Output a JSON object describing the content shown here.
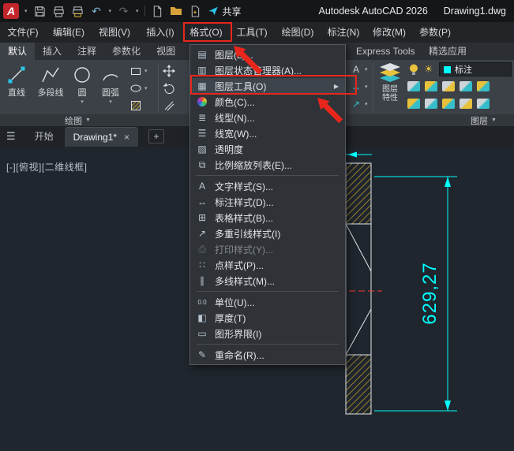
{
  "theme": {
    "accent_red": "#e8261c",
    "logo_red": "#c2262c",
    "dim_cyan": "#00ffff",
    "hatch_yellow": "#b79a2f",
    "centerline_red": "#ff3b30",
    "share_cyan": "#2bc3e8",
    "icon_yellow": "#e8c23c",
    "icon_teal": "#35bdc9"
  },
  "titlebar": {
    "logo_letter": "A",
    "share_label": "共享",
    "app_title": "Autodesk AutoCAD 2026",
    "doc_title": "Drawing1.dwg"
  },
  "menubar": {
    "items": [
      {
        "label": "文件(F)"
      },
      {
        "label": "编辑(E)"
      },
      {
        "label": "视图(V)"
      },
      {
        "label": "插入(I)"
      },
      {
        "label": "格式(O)"
      },
      {
        "label": "工具(T)"
      },
      {
        "label": "绘图(D)"
      },
      {
        "label": "标注(N)"
      },
      {
        "label": "修改(M)"
      },
      {
        "label": "参数(P)"
      }
    ]
  },
  "format_menu": {
    "submenu_glyph": "▶",
    "items": [
      {
        "label": "图层(L)...",
        "glyph": "▤"
      },
      {
        "label": "图层状态管理器(A)...",
        "glyph": "▥"
      },
      {
        "label": "图层工具(O)",
        "glyph": "▦"
      },
      {
        "label": "颜色(C)..."
      },
      {
        "label": "线型(N)...",
        "glyph": "≣"
      },
      {
        "label": "线宽(W)...",
        "glyph": "☰"
      },
      {
        "label": "透明度",
        "glyph": "▨"
      },
      {
        "label": "比例缩放列表(E)...",
        "glyph": "⧉"
      },
      {
        "label": "文字样式(S)...",
        "glyph": "A"
      },
      {
        "label": "标注样式(D)...",
        "glyph": "↔"
      },
      {
        "label": "表格样式(B)...",
        "glyph": "⊞"
      },
      {
        "label": "多重引线样式(I)",
        "glyph": "↗"
      },
      {
        "label": "打印样式(Y)...",
        "glyph": "⎙"
      },
      {
        "label": "点样式(P)...",
        "glyph": "∷"
      },
      {
        "label": "多线样式(M)...",
        "glyph": "∥"
      },
      {
        "label": "单位(U)...",
        "glyph": "0.0"
      },
      {
        "label": "厚度(T)",
        "glyph": "◧"
      },
      {
        "label": "图形界限(I)",
        "glyph": "▭"
      },
      {
        "label": "重命名(R)...",
        "glyph": "✎"
      }
    ]
  },
  "ribbon": {
    "tabs": [
      {
        "label": "默认"
      },
      {
        "label": "插入"
      },
      {
        "label": "注释"
      },
      {
        "label": "参数化"
      },
      {
        "label": "视图"
      },
      {
        "label": "Express Tools"
      },
      {
        "label": "精选应用"
      }
    ],
    "draw_panel": {
      "label": "绘图",
      "buttons": [
        {
          "label": "直线"
        },
        {
          "label": "多段线"
        },
        {
          "label": "圆"
        },
        {
          "label": "圆弧"
        }
      ]
    },
    "layer_panel": {
      "label": "图层",
      "properties_line1": "图层",
      "properties_line2": "特性",
      "layer_name": "标注"
    }
  },
  "doc_tabs": {
    "start_label": "开始",
    "active_label": "Drawing1*"
  },
  "drawing": {
    "viewport_controls": "[-][俯视][二维线框]",
    "dimension_text": "629,27"
  },
  "icons": {
    "caret": "▾",
    "menu_caret": "▼",
    "hamburger": "☰",
    "close": "×",
    "plus": "+",
    "sun": "☀",
    "undo": "↶",
    "redo": "↷",
    "annot_text": "A",
    "annot_dim": "↔",
    "annot_leader": "↗"
  }
}
